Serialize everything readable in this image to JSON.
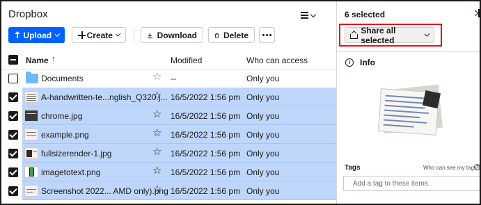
{
  "app": {
    "title": "Dropbox"
  },
  "toolbar": {
    "upload_label": "Upload",
    "create_label": "Create",
    "download_label": "Download",
    "delete_label": "Delete"
  },
  "table": {
    "columns": {
      "name": "Name",
      "sort_indicator": "↑",
      "modified": "Modified",
      "access": "Who can access"
    },
    "rows": [
      {
        "name": "Documents",
        "type": "folder",
        "modified": "--",
        "access": "Only you",
        "selected": false
      },
      {
        "name": "A-handwritten-te...nglish_Q320.j...",
        "type": "image",
        "modified": "16/5/2022 1:56 pm",
        "access": "Only you",
        "selected": true
      },
      {
        "name": "chrome.jpg",
        "type": "image",
        "modified": "16/5/2022 1:56 pm",
        "access": "Only you",
        "selected": true
      },
      {
        "name": "example.png",
        "type": "image",
        "modified": "16/5/2022 1:56 pm",
        "access": "Only you",
        "selected": true
      },
      {
        "name": "fullsizerender-1.jpg",
        "type": "image",
        "modified": "16/5/2022 1:56 pm",
        "access": "Only you",
        "selected": true
      },
      {
        "name": "imagetotext.png",
        "type": "image",
        "modified": "16/5/2022 1:56 pm",
        "access": "Only you",
        "selected": true
      },
      {
        "name": "Screenshot 2022... AMD only).png",
        "type": "image",
        "modified": "16/5/2022 1:56 pm",
        "access": "Only you",
        "selected": true
      }
    ]
  },
  "panel": {
    "selected_count": "6 selected",
    "share_label": "Share all selected",
    "info_label": "Info",
    "tags_label": "Tags",
    "tags_help": "Who can see my tags?",
    "tag_placeholder": "Add a tag to these items",
    "tag_prefix": "#"
  },
  "colors": {
    "accent": "#0061fe",
    "selection": "#bfd6fb",
    "highlight_box": "#e0161c",
    "folder": "#72b8f4"
  },
  "icons": [
    "list-view-icon",
    "chevron-down-icon",
    "upload-icon",
    "plus-icon",
    "download-icon",
    "trash-icon",
    "more-icon",
    "star-icon",
    "folder-icon",
    "share-icon",
    "info-icon",
    "collapse-panel-icon",
    "help-icon"
  ]
}
